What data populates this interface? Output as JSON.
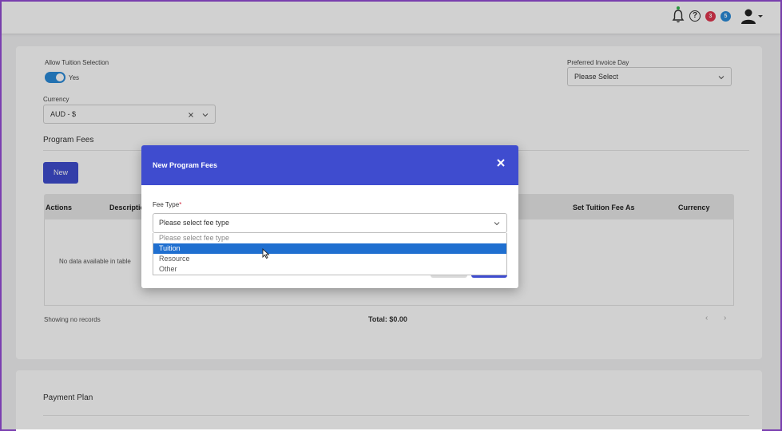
{
  "topbar": {
    "notification_badge_red": "3",
    "notification_badge_blue": "5",
    "help_label": "?"
  },
  "settings": {
    "allow_tuition_label": "Allow Tuition Selection",
    "allow_tuition_toggle_text": "Yes",
    "allow_tuition_enabled": true,
    "preferred_invoice_day_label": "Preferred Invoice Day",
    "preferred_invoice_day_value": "Please Select",
    "currency_label": "Currency",
    "currency_value": "AUD - $"
  },
  "program_fees": {
    "title": "Program Fees",
    "new_button": "New",
    "columns": [
      "Actions",
      "Descriptio",
      "Set Tuition Fee As",
      "Currency"
    ],
    "empty_message": "No data available in table",
    "showing": "Showing no records",
    "total": "Total: $0.00",
    "prev": "‹",
    "next": "›"
  },
  "payment_plan": {
    "title": "Payment Plan"
  },
  "modal": {
    "title": "New Program Fees",
    "close_label": "✕",
    "fee_type_label": "Fee Type",
    "required_mark": "*",
    "fee_type_value": "Please select fee type",
    "options": [
      "Please select fee type",
      "Tuition",
      "Resource",
      "Other"
    ],
    "highlighted_option_index": 1
  },
  "colors": {
    "primary": "#3f4ccf",
    "toggle": "#2a8ad8",
    "highlight": "#1f6fd0",
    "badge_red": "#e0364f",
    "badge_blue": "#2a8ad8",
    "frame": "#7a3fb0"
  }
}
